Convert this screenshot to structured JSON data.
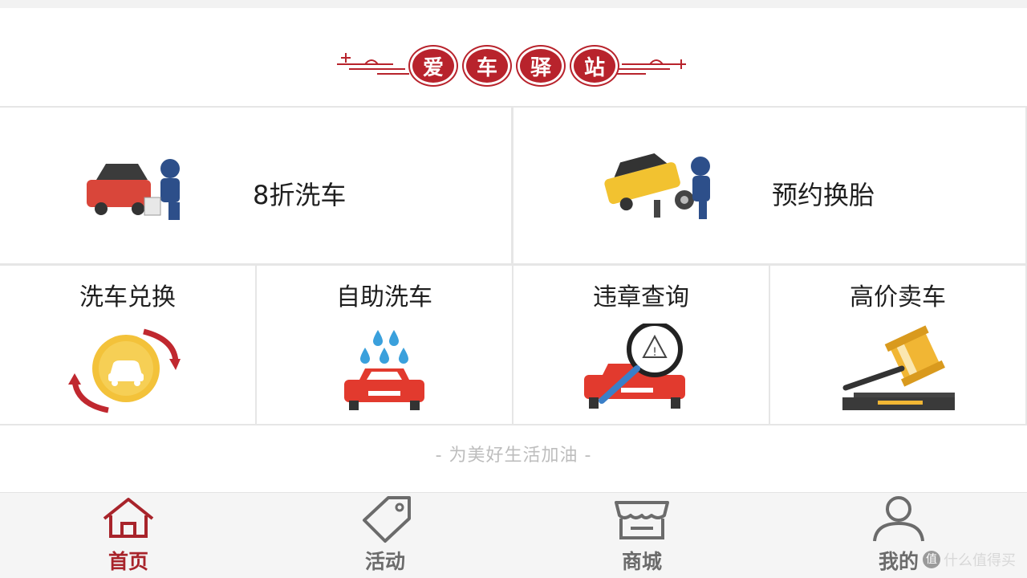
{
  "banner": {
    "title_chars": [
      "爱",
      "车",
      "驿",
      "站"
    ],
    "accent_color": "#b8232c"
  },
  "services_featured": [
    {
      "label": "8折洗车",
      "icon": "car-wash-worker-icon"
    },
    {
      "label": "预约换胎",
      "icon": "tire-change-worker-icon"
    }
  ],
  "services": [
    {
      "label": "洗车兑换",
      "icon": "coin-exchange-icon"
    },
    {
      "label": "自助洗车",
      "icon": "self-wash-car-icon"
    },
    {
      "label": "违章查询",
      "icon": "violation-search-icon"
    },
    {
      "label": "高价卖车",
      "icon": "auction-gavel-icon"
    }
  ],
  "slogan": "- 为美好生活加油 -",
  "tabbar": {
    "active_color": "#a8242b",
    "inactive_color": "#6b6b6b",
    "tabs": [
      {
        "label": "首页",
        "icon": "home-icon",
        "active": true
      },
      {
        "label": "活动",
        "icon": "tag-icon",
        "active": false
      },
      {
        "label": "商城",
        "icon": "store-icon",
        "active": false
      },
      {
        "label": "我的",
        "icon": "user-icon",
        "active": false
      }
    ]
  },
  "watermark": "什么值得买"
}
